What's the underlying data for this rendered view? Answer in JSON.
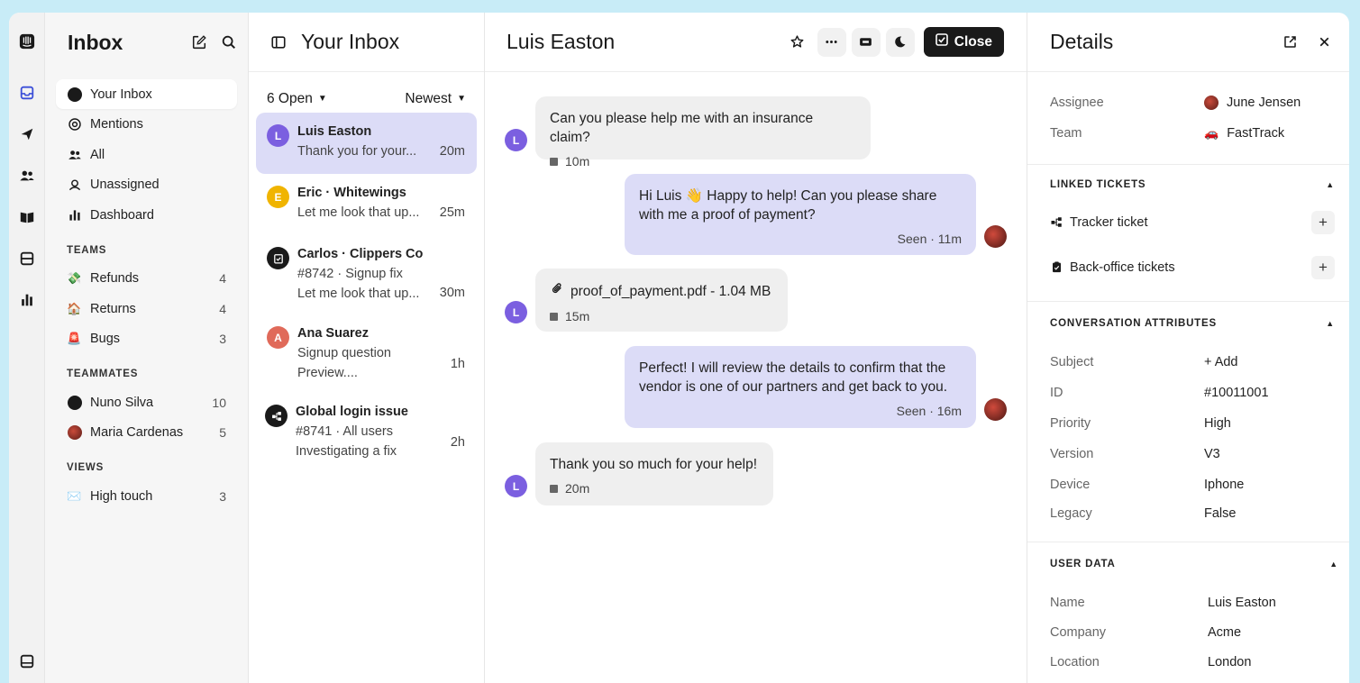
{
  "rail": {
    "icons": [
      "intercom-logo-icon",
      "inbox-icon",
      "send-icon",
      "contacts-icon",
      "knowledge-book-icon",
      "tickets-icon",
      "reports-icon",
      "bottom-inbox-icon"
    ]
  },
  "sidebar": {
    "title": "Inbox",
    "items": [
      {
        "label": "Your Inbox",
        "icon": "avatar-dot"
      },
      {
        "label": "Mentions",
        "icon": "at-icon"
      },
      {
        "label": "All",
        "icon": "people-icon"
      },
      {
        "label": "Unassigned",
        "icon": "unassigned-icon"
      },
      {
        "label": "Dashboard",
        "icon": "bar-chart-icon"
      }
    ],
    "teams_title": "TEAMS",
    "teams": [
      {
        "label": "Refunds",
        "count": "4",
        "emoji": "💸"
      },
      {
        "label": "Returns",
        "count": "4",
        "emoji": "🏠"
      },
      {
        "label": "Bugs",
        "count": "3",
        "emoji": "🚨"
      }
    ],
    "teammates_title": "TEAMMATES",
    "teammates": [
      {
        "label": "Nuno Silva",
        "count": "10"
      },
      {
        "label": "Maria Cardenas",
        "count": "5"
      }
    ],
    "views_title": "VIEWS",
    "views": [
      {
        "label": "High touch",
        "count": "3",
        "emoji": "✉️"
      }
    ]
  },
  "convlist": {
    "title": "Your Inbox",
    "filter_open": "6 Open",
    "filter_sort": "Newest",
    "items": [
      {
        "name": "Luis Easton",
        "lines": [
          "Thank you for your..."
        ],
        "time": "20m",
        "avatar": "L",
        "color": "#7b5fe0"
      },
      {
        "name": "Eric · Whitewings",
        "lines": [
          "Let me look that up..."
        ],
        "time": "25m",
        "avatar": "E",
        "color": "#f0b400"
      },
      {
        "name": "Carlos · Clippers Co",
        "lines": [
          "#8742   · Signup fix",
          "Let me look that up..."
        ],
        "time": "30m",
        "avatar": "",
        "color": "#1a1a1a"
      },
      {
        "name": "Ana Suarez",
        "lines": [
          "Signup question",
          "Preview...."
        ],
        "time": "1h",
        "avatar": "A",
        "color": "#e06a5a"
      },
      {
        "name": "Global login issue",
        "lines": [
          "#8741  · All users",
          "Investigating a fix"
        ],
        "time": "2h",
        "avatar": "",
        "color": "#1a1a1a"
      }
    ]
  },
  "main": {
    "title": "Luis Easton",
    "close_label": "Close",
    "messages": [
      {
        "text": "Can you please help me with an insurance claim?",
        "meta": "10m"
      },
      {
        "text": "Hi Luis 👋 Happy to help! Can you please share with me a proof of payment?",
        "meta": "Seen ·  11m"
      },
      {
        "text": "proof_of_payment.pdf - 1.04 MB",
        "meta": "15m"
      },
      {
        "text": "Perfect! I will review the details to confirm that the vendor is one of our partners and get back to you.",
        "meta": "Seen ·  16m"
      },
      {
        "text": "Thank you so much for your help!",
        "meta": "20m"
      }
    ],
    "avatar_letter": "L"
  },
  "details": {
    "title": "Details",
    "assignee_label": "Assignee",
    "assignee_value": "June Jensen",
    "team_label": "Team",
    "team_value": "FastTrack",
    "linked_title": "LINKED TICKETS",
    "tracker_label": "Tracker ticket",
    "backoffice_label": "Back-office tickets",
    "attrs_title": "CONVERSATION ATTRIBUTES",
    "attrs": [
      {
        "k": "Subject",
        "v": "+ Add"
      },
      {
        "k": "ID",
        "v": "#10011001"
      },
      {
        "k": "Priority",
        "v": "High"
      },
      {
        "k": "Version",
        "v": "V3"
      },
      {
        "k": "Device",
        "v": "Iphone"
      },
      {
        "k": "Legacy",
        "v": "False"
      }
    ],
    "user_title": "USER DATA",
    "user": [
      {
        "k": "Name",
        "v": "Luis Easton"
      },
      {
        "k": "Company",
        "v": "Acme"
      },
      {
        "k": "Location",
        "v": "London"
      }
    ]
  }
}
